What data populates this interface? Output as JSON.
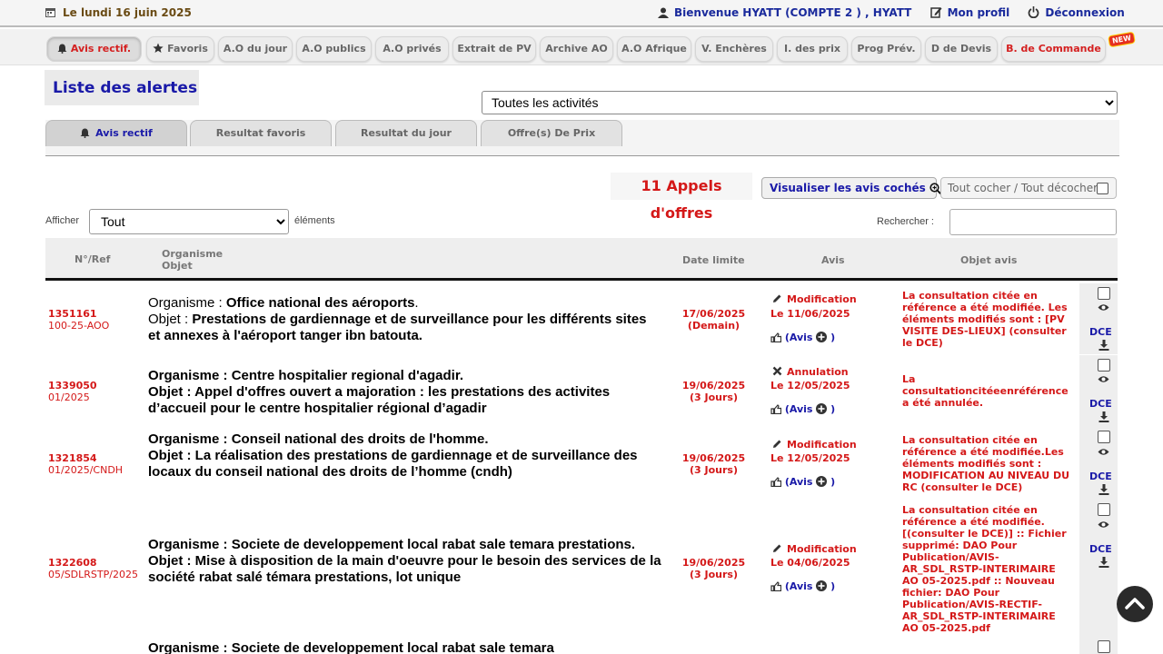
{
  "header": {
    "date": "Le lundi 16 juin 2025",
    "welcome": "Bienvenue HYATT (COMPTE 2 ) , HYATT",
    "profile": "Mon profil",
    "logout": "Déconnexion"
  },
  "nav": {
    "items": [
      {
        "label": "Avis rectif."
      },
      {
        "label": "Favoris"
      },
      {
        "label": "A.O du jour"
      },
      {
        "label": "A.O publics"
      },
      {
        "label": "A.O privés"
      },
      {
        "label": "Extrait de PV"
      },
      {
        "label": "Archive AO"
      },
      {
        "label": "A.O Afrique"
      },
      {
        "label": "V. Enchères"
      },
      {
        "label": "I. des prix"
      },
      {
        "label": "Prog Prév."
      },
      {
        "label": "D de Devis"
      },
      {
        "label": "B. de Commande"
      }
    ],
    "new_badge": "NEW"
  },
  "page": {
    "title": "Liste des alertes",
    "activity_select": "Toutes les activités"
  },
  "subtabs": [
    {
      "label": "Avis rectif"
    },
    {
      "label": "Resultat favoris"
    },
    {
      "label": "Resultat du jour"
    },
    {
      "label": "Offre(s) De Prix"
    }
  ],
  "toolbar": {
    "count": "11 Appels d'offres",
    "visualize": "Visualiser les avis cochés",
    "check_all": "Tout cocher / Tout décocher"
  },
  "list_controls": {
    "show_label": "Afficher",
    "show_value": "Tout",
    "elements_label": "éléments",
    "search_label": "Rechercher :"
  },
  "table": {
    "headers": {
      "ref": "N°/Ref",
      "organisme": "Organisme",
      "objet": "Objet",
      "date": "Date limite",
      "avis": "Avis",
      "objet_avis": "Objet avis"
    },
    "labels": {
      "organisme": "Organisme : ",
      "objet": "Objet : ",
      "avis_link": "Avis",
      "dce": "DCE"
    },
    "rows": [
      {
        "num": "1351161",
        "ref": "100-25-AOO",
        "organisme": "Office national des aéroports",
        "objet": "Prestations de gardiennage et de surveillance pour les différents sites et annexes à l'aéroport tanger ibn batouta.",
        "date": "17/06/2025",
        "date_note": "(Demain)",
        "avis_type": "Modification",
        "avis_date": "Le 11/06/2025",
        "objet_avis": "La consultation citée en référence a été modifiée. Les éléments modifiés sont : [PV VISITE DES-LIEUX] (consulter le DCE)"
      },
      {
        "num": "1339050",
        "ref": "01/2025",
        "organisme": "Centre hospitalier regional d'agadir.",
        "objet": "Appel d'offres ouvert a majoration : les prestations des activites d’accueil pour le centre hospitalier régional d’agadir",
        "date": "19/06/2025",
        "date_note": "(3 Jours)",
        "avis_type": "Annulation",
        "avis_date": "Le 12/05/2025",
        "objet_avis": "La consultationcitéeenréférence a été annulée."
      },
      {
        "num": "1321854",
        "ref": "01/2025/CNDH",
        "organisme": "Conseil national des droits de l'homme.",
        "objet": "La réalisation des prestations de gardiennage et de surveillance des locaux du conseil national des droits de l’homme (cndh)",
        "date": "19/06/2025",
        "date_note": "(3 Jours)",
        "avis_type": "Modification",
        "avis_date": "Le 12/05/2025",
        "objet_avis": "La consultation citée en référence a été modifiée.Les éléments modifiés sont : MODIFICATION AU NIVEAU DU RC (consulter le DCE)"
      },
      {
        "num": "1322608",
        "ref": "05/SDLRSTP/2025",
        "organisme": "Societe de developpement local rabat sale temara prestations.",
        "objet": "Mise à disposition de la main d'oeuvre pour le besoin des services de la société rabat salé témara prestations, lot unique",
        "date": "19/06/2025",
        "date_note": "(3 Jours)",
        "avis_type": "Modification",
        "avis_date": "Le 04/06/2025",
        "objet_avis": "La consultation citée en référence a été modifiée. [(consulter le DCE)] :: Fichier supprimé: DAO Pour Publication/AVIS-AR_SDL_RSTP-INTERIMAIRE AO 05-2025.pdf :: Nouveau fichier: DAO Pour Publication/AVIS-RECTIF-AR_SDL_RSTP-INTERIMAIRE AO 05-2025.pdf"
      },
      {
        "organisme": "Societe de developpement local rabat sale temara"
      }
    ]
  }
}
